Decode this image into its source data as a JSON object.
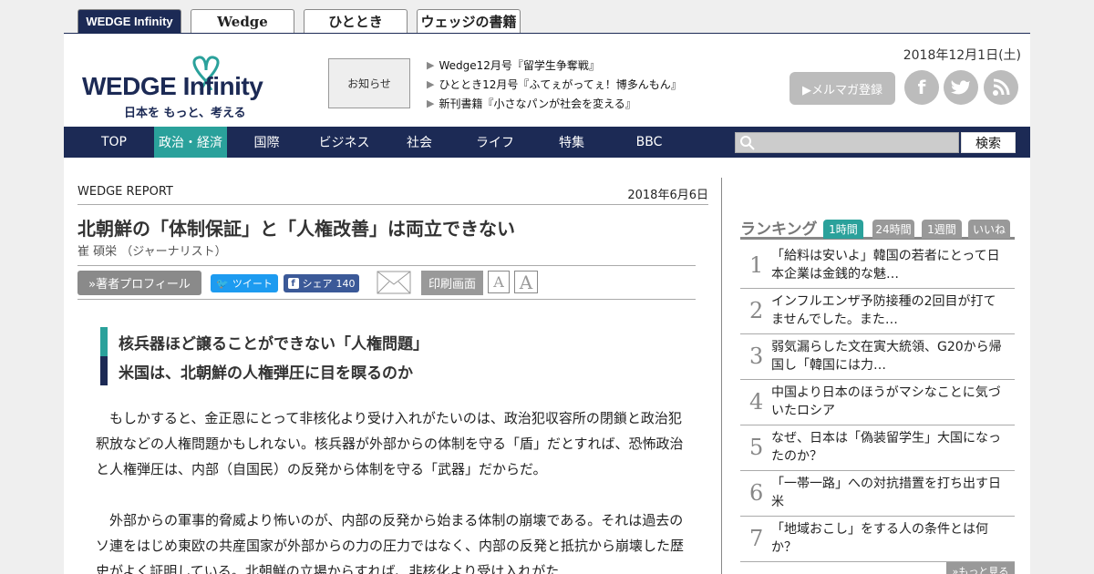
{
  "site_tabs": [
    "WEDGE Infinity",
    "Wedge",
    "ひととき",
    "ウェッジの書籍"
  ],
  "header": {
    "logo_main": "WEDGE",
    "logo_inf": "Infinity",
    "logo_tagline": "日本を もっと、考える",
    "notice": "お知らせ",
    "news": [
      "Wedge12月号『留学生争奪戦』",
      "ひととき12月号『ふてぇがってぇ！博多んもん』",
      "新刊書籍『小さなパンが社会を変える』"
    ],
    "date": "2018年12月1日(土)",
    "mag_button": "▶メルマガ登録"
  },
  "nav": {
    "items": [
      "TOP",
      "政治・経済",
      "国際",
      "ビジネス",
      "社会",
      "ライフ",
      "特集",
      "BBC"
    ],
    "search_button": "検索"
  },
  "article": {
    "category": "WEDGE REPORT",
    "date": "2018年6月6日",
    "title": "北朝鮮の「体制保証」と「人権改善」は両立できない",
    "author": "崔 碩栄 （ジャーナリスト）",
    "profile_button": "»著者プロフィール",
    "tweet": "ツイート",
    "share": "シェア",
    "share_count": "140",
    "print": "印刷画面",
    "font_small": "A",
    "font_large": "A",
    "leads": [
      "核兵器ほど譲ることができない「人権問題」",
      "米国は、北朝鮮の人権弾圧に目を瞑るのか"
    ],
    "paragraphs": [
      "もしかすると、金正恩にとって非核化より受け入れがたいのは、政治犯収容所の閉鎖と政治犯釈放などの人権問題かもしれない。核兵器が外部からの体制を守る「盾」だとすれば、恐怖政治と人権弾圧は、内部（自国民）の反発から体制を守る「武器」だからだ。",
      "外部からの軍事的脅威より怖いのが、内部の反発から始まる体制の崩壊である。それは過去のソ連をはじめ東欧の共産国家が外部からの力の圧力ではなく、内部の反発と抵抗から崩壊した歴史がよく証明している。北朝鮮の立場からすれば、非核化より受け入れがた"
    ]
  },
  "ranking": {
    "title": "ランキング",
    "tabs": [
      "1時間",
      "24時間",
      "1週間",
      "いいね"
    ],
    "items": [
      {
        "num": "1",
        "text": "「給料は安いよ」韓国の若者にとって日本企業は金銭的な魅…"
      },
      {
        "num": "2",
        "text": "インフルエンザ予防接種の2回目が打てませんでした。また…"
      },
      {
        "num": "3",
        "text": "弱気漏らした文在寅大統領、G20から帰国し「韓国には力…"
      },
      {
        "num": "4",
        "text": "中国より日本のほうがマシなことに気づいたロシア"
      },
      {
        "num": "5",
        "text": "なぜ、日本は「偽装留学生」大国になったのか？"
      },
      {
        "num": "6",
        "text": "「一帯一路」への対抗措置を打ち出す日米"
      },
      {
        "num": "7",
        "text": "「地域おこし」をする人の条件とは何か？"
      }
    ],
    "more": "»もっと見る"
  },
  "colors": {
    "navy": "#1c2a55",
    "teal": "#2aa19b"
  }
}
